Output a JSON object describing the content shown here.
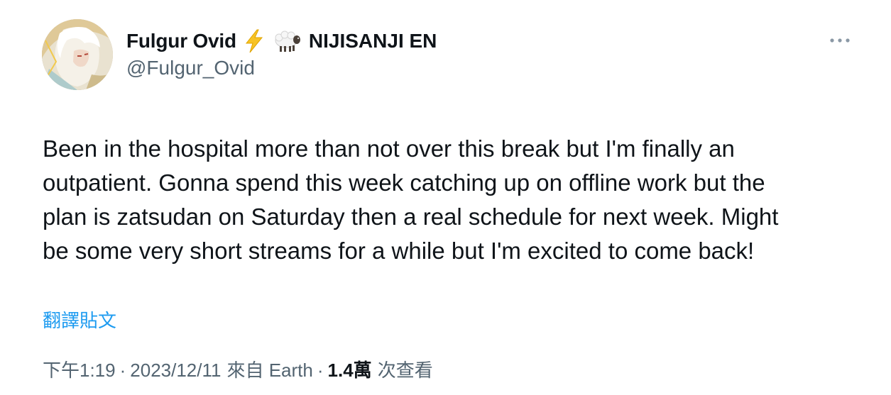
{
  "author": {
    "display_name": "Fulgur Ovid",
    "badge_emoji_1": "lightning-bolt",
    "badge_emoji_2": "sheep",
    "org_name": "NIJISANJI EN",
    "handle": "@Fulgur_Ovid"
  },
  "tweet": {
    "text": "Been in the hospital more than not over this break but I'm finally an\noutpatient. Gonna spend this week catching up on offline work but the\nplan is zatsudan on Saturday then a real schedule for next week. Might\nbe some very short streams for a while but I'm excited to come back!",
    "translate_label": "翻譯貼文"
  },
  "meta": {
    "time": "下午1:19",
    "separator": "·",
    "date": "2023/12/11",
    "source": "來自 Earth",
    "views_count": "1.4萬",
    "views_label": "次查看"
  },
  "colors": {
    "text_primary": "#0f1419",
    "text_secondary": "#536471",
    "link": "#1d9bf0"
  }
}
